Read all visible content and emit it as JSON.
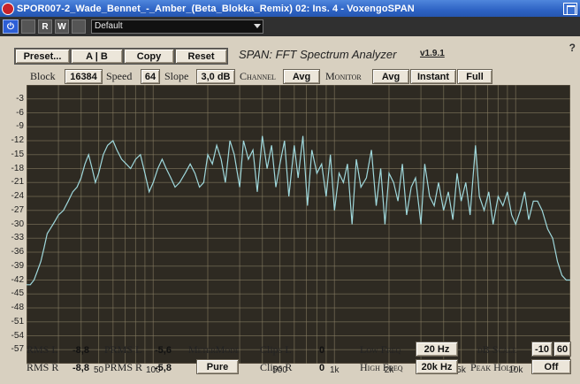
{
  "window": {
    "title": "SPOR007-2_Wade_Bennet_-_Amber_(Beta_Blokka_Remix) 02: Ins. 4 - VoxengoSPAN"
  },
  "host_toolbar": {
    "power_label": "⏻",
    "read_label": "R",
    "write_label": "W",
    "preset_value": "Default"
  },
  "plugin": {
    "help_label": "?",
    "preset_button": "Preset...",
    "ab_button": "A | B",
    "copy_button": "Copy",
    "reset_button": "Reset",
    "logo_text": "SPAN: FFT Spectrum Analyzer",
    "version": "v1.9.1"
  },
  "controls": {
    "block_label": "Block",
    "block_value": "16384",
    "speed_label": "Speed",
    "speed_value": "64",
    "slope_label": "Slope",
    "slope_value": "3,0 dB",
    "channel_label": "Channel",
    "channel_value": "Avg",
    "monitor_label": "Monitor",
    "monitor_value": "Avg",
    "instant_label": "Instant",
    "full_label": "Full"
  },
  "meters": {
    "rms_l_label": "RMS  L",
    "rms_l_value": "-8,8",
    "prms_l_label": "PRMS  L",
    "prms_l_value": "-5,6",
    "rms_r_label": "RMS  R",
    "rms_r_value": "-8,8",
    "prms_r_label": "PRMS  R",
    "prms_r_value": "-5,8",
    "metermode_label": "MeterMode",
    "metermode_value": "Pure",
    "clips_l_label": "Clips  L",
    "clips_l_value": "0",
    "clips_r_label": "Clips  R",
    "clips_r_value": "0",
    "low_freq_label": "Low  Freq",
    "low_freq_value": "20 Hz",
    "high_freq_label": "High  Freq",
    "high_freq_value": "20k Hz",
    "db_scale_label": "dB  Scale",
    "db_scale_min": "-10",
    "db_scale_max": "60",
    "peak_hold_label": "Peak  Hold",
    "peak_hold_value": "Off"
  },
  "colors": {
    "plot_bg": "#2e2a22",
    "grid": "#8d8266",
    "trace": "#9fd8dc",
    "accent": "#2c5ed6"
  },
  "chart_data": {
    "type": "line",
    "x_scale": "log",
    "xlim": [
      20,
      20000
    ],
    "ylim": [
      -60,
      0
    ],
    "y_ticks": [
      "-3",
      "-6",
      "-9",
      "-12",
      "-15",
      "-18",
      "-21",
      "-24",
      "-27",
      "-30",
      "-33",
      "-36",
      "-39",
      "-42",
      "-45",
      "-48",
      "-51",
      "-54",
      "-57"
    ],
    "x_ticks": [
      "50",
      "100",
      "200",
      "500",
      "1k",
      "2k",
      "5k",
      "10k"
    ],
    "series": [
      {
        "x": [
          20,
          21,
          22,
          23,
          24,
          25,
          26,
          27,
          28,
          29,
          30,
          32,
          34,
          36,
          38,
          40,
          42,
          44,
          46,
          48,
          50,
          53,
          56,
          60,
          63,
          67,
          71,
          75,
          80,
          85,
          90,
          95,
          100,
          106,
          112,
          118,
          125,
          132,
          140,
          150,
          160,
          170,
          180,
          190,
          200,
          212,
          224,
          237,
          250,
          265,
          280,
          300,
          315,
          335,
          355,
          375,
          400,
          425,
          450,
          475,
          500,
          530,
          560,
          600,
          630,
          670,
          710,
          750,
          800,
          850,
          900,
          950,
          1000,
          1060,
          1120,
          1180,
          1250,
          1320,
          1400,
          1500,
          1600,
          1700,
          1800,
          1900,
          2000,
          2120,
          2240,
          2370,
          2500,
          2650,
          2800,
          3000,
          3150,
          3350,
          3550,
          3750,
          4000,
          4250,
          4500,
          4750,
          5000,
          5300,
          5600,
          6000,
          6300,
          6700,
          7100,
          7500,
          8000,
          8500,
          9000,
          9500,
          10000,
          10600,
          11200,
          11800,
          12500,
          13200,
          14000,
          15000,
          16000,
          17000,
          18000,
          19000,
          20000
        ],
        "y": [
          -43,
          -43,
          -42,
          -40,
          -38,
          -35,
          -32,
          -31,
          -30,
          -29,
          -28,
          -27,
          -25,
          -23,
          -22,
          -20,
          -17,
          -15,
          -18,
          -21,
          -19,
          -15,
          -13,
          -12,
          -14,
          -16,
          -17,
          -18,
          -16,
          -15,
          -19,
          -23,
          -21,
          -18,
          -16,
          -18,
          -20,
          -22,
          -21,
          -19,
          -17,
          -19,
          -22,
          -21,
          -15,
          -17,
          -13,
          -16,
          -21,
          -12,
          -15,
          -22,
          -12,
          -16,
          -14,
          -23,
          -11,
          -18,
          -13,
          -22,
          -17,
          -12,
          -24,
          -13,
          -20,
          -11,
          -26,
          -14,
          -19,
          -17,
          -24,
          -15,
          -27,
          -19,
          -21,
          -17,
          -30,
          -16,
          -22,
          -20,
          -14,
          -26,
          -18,
          -30,
          -19,
          -21,
          -25,
          -17,
          -28,
          -22,
          -20,
          -30,
          -17,
          -24,
          -26,
          -21,
          -27,
          -23,
          -29,
          -19,
          -25,
          -21,
          -28,
          -13,
          -24,
          -27,
          -23,
          -30,
          -24,
          -26,
          -23,
          -28,
          -30,
          -27,
          -23,
          -29,
          -25,
          -25,
          -27,
          -31,
          -33,
          -38,
          -41,
          -42,
          -42
        ]
      }
    ]
  }
}
